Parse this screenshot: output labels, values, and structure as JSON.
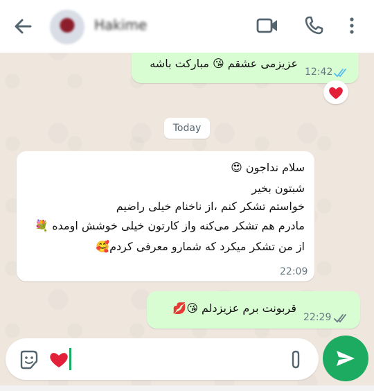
{
  "header": {
    "contact_name": "Hakime",
    "icons": [
      "back-arrow-icon",
      "video-call-icon",
      "phone-icon",
      "more-options-icon"
    ]
  },
  "messages": [
    {
      "direction": "outgoing",
      "lines": [
        "عزیزمی عشقم 😘 مبارکت باشه"
      ],
      "time": "12:42",
      "status": "read",
      "reaction": "❤️"
    },
    {
      "direction": "incoming",
      "lines": [
        "سلام نداجون 😍",
        "شبتون بخیر",
        "خواستم تشکر کنم ،از ناخنام خیلی راضیم",
        "مادرم هم تشکر می‌کنه واز کارتون خیلی خوشش اومده 💐",
        "از من تشکر میکرد که شمارو معرفی کردم🥰"
      ],
      "time": "22:09"
    },
    {
      "direction": "outgoing",
      "lines": [
        "قربونت برم عزیزدلم 😘💋"
      ],
      "time": "22:29",
      "status": "delivered"
    }
  ],
  "date_separator": "Today",
  "composer": {
    "text": "❤️",
    "icons": [
      "sticker-icon",
      "attach-icon",
      "send-icon"
    ]
  },
  "colors": {
    "wallpaper": "#efe7de",
    "outgoing_bubble": "#d9fdd3",
    "incoming_bubble": "#ffffff",
    "accent_green": "#1daa61",
    "read_ticks": "#53bdeb",
    "delivered_ticks": "#667781"
  }
}
